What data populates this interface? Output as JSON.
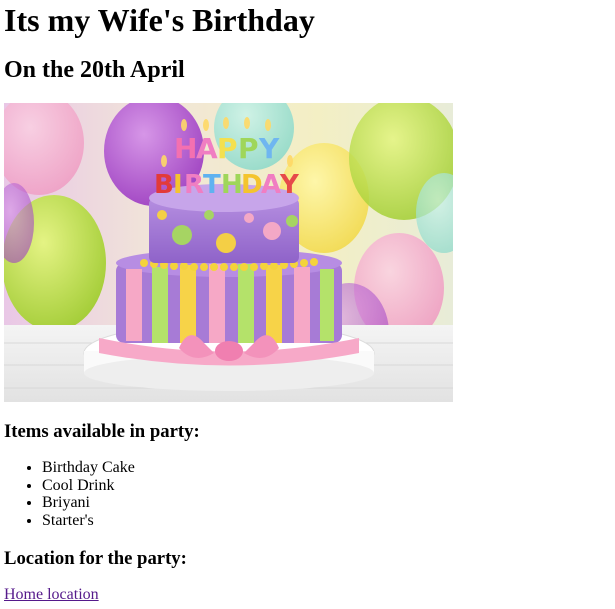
{
  "page": {
    "title": "Its my Wife's Birthday",
    "subtitle": "On the 20th April"
  },
  "hero_image": {
    "subject": "birthday cake with HAPPY BIRTHDAY candles and balloons",
    "candle_text_line1": "HAPPY",
    "candle_text_line2": "BIRTHDAY"
  },
  "items": {
    "heading": "Items available in party:",
    "list": [
      "Birthday Cake",
      "Cool Drink",
      "Briyani",
      "Starter's"
    ]
  },
  "location": {
    "heading": "Location for the party:",
    "link_label": "Home location"
  },
  "colors": {
    "link_visited": "#551a8b",
    "text": "#000000"
  }
}
